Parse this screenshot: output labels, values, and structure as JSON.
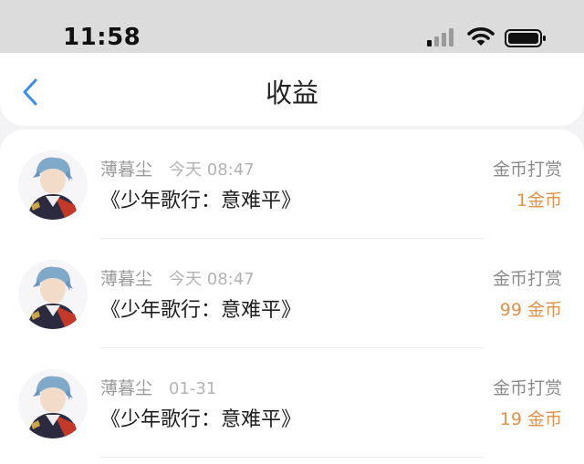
{
  "status_bar": {
    "time": "11:58",
    "signal_icon": "cellular-signal-icon",
    "wifi_icon": "wifi-icon",
    "battery_icon": "battery-icon"
  },
  "nav": {
    "back_icon": "chevron-left-icon",
    "title": "收益",
    "accent_color": "#3a8ee6"
  },
  "colors": {
    "amount": "#e0914a",
    "secondary_text": "#9a9a9a"
  },
  "records": [
    {
      "name": "薄暮尘",
      "time": "今天 08:47",
      "work": "《少年歌行：意难平》",
      "type": "金币打赏",
      "amount": "1金币"
    },
    {
      "name": "薄暮尘",
      "time": "今天 08:47",
      "work": "《少年歌行：意难平》",
      "type": "金币打赏",
      "amount": "99 金币"
    },
    {
      "name": "薄暮尘",
      "time": "01-31",
      "work": "《少年歌行：意难平》",
      "type": "金币打赏",
      "amount": "19 金币"
    }
  ]
}
